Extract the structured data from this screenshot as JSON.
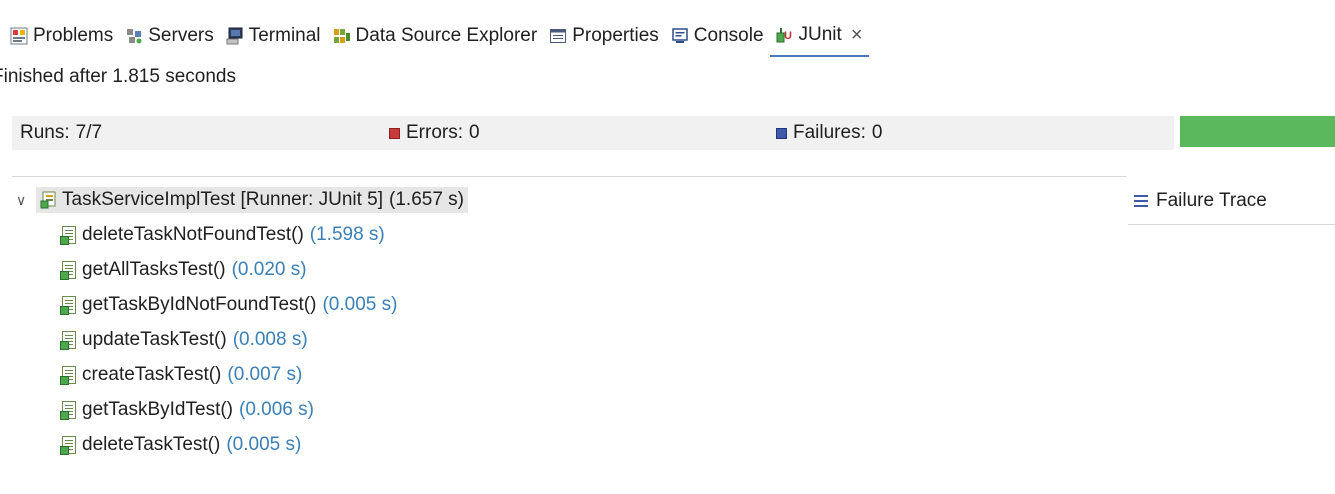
{
  "tabs": [
    {
      "id": "problems",
      "label": "Problems",
      "icon": "problems-icon"
    },
    {
      "id": "servers",
      "label": "Servers",
      "icon": "servers-icon"
    },
    {
      "id": "terminal",
      "label": "Terminal",
      "icon": "terminal-icon"
    },
    {
      "id": "datasource",
      "label": "Data Source Explorer",
      "icon": "data-source-icon"
    },
    {
      "id": "properties",
      "label": "Properties",
      "icon": "properties-icon"
    },
    {
      "id": "console",
      "label": "Console",
      "icon": "console-icon"
    },
    {
      "id": "junit",
      "label": "JUnit",
      "icon": "junit-icon",
      "active": true
    }
  ],
  "status": {
    "text": "Finished after 1.815 seconds"
  },
  "counters": {
    "runs_label": "Runs:",
    "runs_value": "7/7",
    "errors_label": "Errors:",
    "errors_value": "0",
    "failures_label": "Failures:",
    "failures_value": "0"
  },
  "progress": {
    "fraction": 1.0,
    "color": "#5cb85c"
  },
  "tree": {
    "root": {
      "label": "TaskServiceImplTest [Runner: JUnit 5]",
      "time": "(1.657 s)"
    },
    "tests": [
      {
        "name": "deleteTaskNotFoundTest()",
        "time": "(1.598 s)"
      },
      {
        "name": "getAllTasksTest()",
        "time": "(0.020 s)"
      },
      {
        "name": "getTaskByIdNotFoundTest()",
        "time": "(0.005 s)"
      },
      {
        "name": "updateTaskTest()",
        "time": "(0.008 s)"
      },
      {
        "name": "createTaskTest()",
        "time": "(0.007 s)"
      },
      {
        "name": "getTaskByIdTest()",
        "time": "(0.006 s)"
      },
      {
        "name": "deleteTaskTest()",
        "time": "(0.005 s)"
      }
    ]
  },
  "failure_trace": {
    "label": "Failure Trace"
  },
  "colors": {
    "accent": "#4a78b6",
    "success": "#5cb85c",
    "time": "#3a7fb6"
  }
}
